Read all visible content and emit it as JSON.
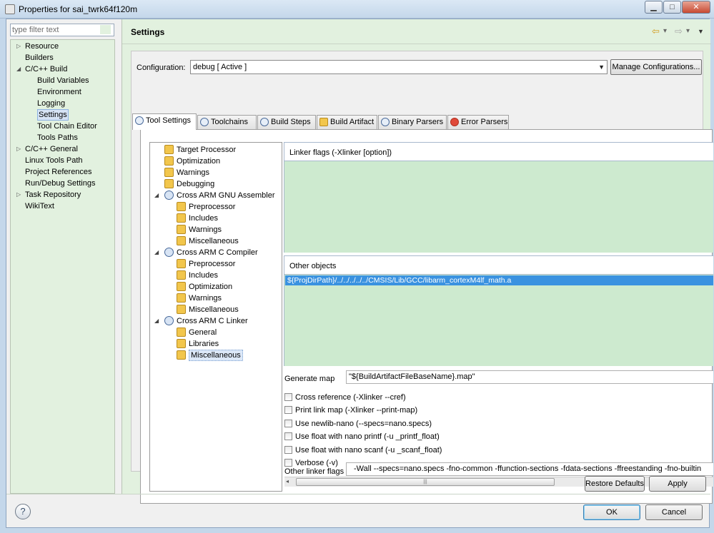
{
  "window": {
    "title": "Properties for sai_twrk64f120m",
    "buttons": {
      "minimize": "▁",
      "maximize": "□",
      "close": "✕"
    }
  },
  "sidebar": {
    "filter_placeholder": "type filter text",
    "items": [
      {
        "label": "Resource",
        "expandable": true
      },
      {
        "label": "Builders",
        "expandable": false
      },
      {
        "label": "C/C++ Build",
        "expandable": true,
        "expanded": true
      },
      {
        "label": "Build Variables",
        "expandable": false
      },
      {
        "label": "Environment",
        "expandable": false
      },
      {
        "label": "Logging",
        "expandable": false
      },
      {
        "label": "Settings",
        "expandable": false,
        "selected": true
      },
      {
        "label": "Tool Chain Editor",
        "expandable": false
      },
      {
        "label": "Tools Paths",
        "expandable": false
      },
      {
        "label": "C/C++ General",
        "expandable": true
      },
      {
        "label": "Linux Tools Path",
        "expandable": false
      },
      {
        "label": "Project References",
        "expandable": false
      },
      {
        "label": "Run/Debug Settings",
        "expandable": false
      },
      {
        "label": "Task Repository",
        "expandable": true
      },
      {
        "label": "WikiText",
        "expandable": false
      }
    ]
  },
  "header": {
    "title": "Settings",
    "nav": {
      "back": "⇦",
      "back_menu": "▾",
      "forward": "⇨",
      "forward_menu": "▾",
      "view_menu": "▼"
    }
  },
  "config": {
    "label": "Configuration:",
    "value": "debug  [ Active ]",
    "arrow": "▼",
    "manage_label": "Manage Configurations..."
  },
  "tabs": [
    {
      "label": "Tool Settings",
      "selected": true
    },
    {
      "label": "Toolchains"
    },
    {
      "label": "Build Steps"
    },
    {
      "label": "Build Artifact"
    },
    {
      "label": "Binary Parsers"
    },
    {
      "label": "Error Parsers"
    }
  ],
  "tool_tree": [
    {
      "label": "Target Processor",
      "icon": "folder-settings-icon"
    },
    {
      "label": "Optimization",
      "icon": "folder-settings-icon"
    },
    {
      "label": "Warnings",
      "icon": "folder-settings-icon"
    },
    {
      "label": "Debugging",
      "icon": "folder-settings-icon"
    },
    {
      "label": "Cross ARM GNU Assembler",
      "icon": "tool-gear-icon"
    },
    {
      "label": "Preprocessor",
      "icon": "folder-settings-icon"
    },
    {
      "label": "Includes",
      "icon": "folder-settings-icon"
    },
    {
      "label": "Warnings",
      "icon": "folder-settings-icon"
    },
    {
      "label": "Miscellaneous",
      "icon": "folder-settings-icon"
    },
    {
      "label": "Cross ARM C Compiler",
      "icon": "tool-gear-icon"
    },
    {
      "label": "Preprocessor",
      "icon": "folder-settings-icon"
    },
    {
      "label": "Includes",
      "icon": "folder-settings-icon"
    },
    {
      "label": "Optimization",
      "icon": "folder-settings-icon"
    },
    {
      "label": "Warnings",
      "icon": "folder-settings-icon"
    },
    {
      "label": "Miscellaneous",
      "icon": "folder-settings-icon"
    },
    {
      "label": "Cross ARM C Linker",
      "icon": "tool-gear-icon"
    },
    {
      "label": "General",
      "icon": "folder-settings-icon"
    },
    {
      "label": "Libraries",
      "icon": "folder-settings-icon"
    },
    {
      "label": "Miscellaneous",
      "icon": "folder-settings-icon",
      "selected": true
    }
  ],
  "linker_flags": {
    "title": "Linker flags (-Xlinker [option])"
  },
  "other_objects": {
    "title": "Other objects",
    "items": [
      "${ProjDirPath}/../../../../../CMSIS/Lib/GCC/libarm_cortexM4lf_math.a"
    ]
  },
  "generate_map": {
    "label": "Generate map",
    "value": "\"${BuildArtifactFileBaseName}.map\""
  },
  "checkboxes": [
    {
      "label": "Cross reference (-Xlinker --cref)",
      "checked": false
    },
    {
      "label": "Print link map (-Xlinker --print-map)",
      "checked": false
    },
    {
      "label": "Use newlib-nano (--specs=nano.specs)",
      "checked": false
    },
    {
      "label": "Use float with nano printf (-u _printf_float)",
      "checked": false
    },
    {
      "label": "Use float with nano scanf (-u _scanf_float)",
      "checked": false
    },
    {
      "label": "Verbose (-v)",
      "checked": false
    }
  ],
  "other_linker_flags": {
    "label": "Other linker flags",
    "value": "-Wall  --specs=nano.specs       -fno-common  -ffunction-sections  -fdata-sections  -ffreestanding  -fno-builtin"
  },
  "scrollbar": {
    "left_arrow": "◂",
    "grip": "|||"
  },
  "buttons": {
    "restore_defaults": "Restore Defaults",
    "apply": "Apply",
    "ok": "OK",
    "cancel": "Cancel",
    "help": "?"
  },
  "colors": {
    "panel_green": "#e2f1df",
    "list_green": "#cdeacf",
    "selection_blue": "#3a92e0"
  }
}
